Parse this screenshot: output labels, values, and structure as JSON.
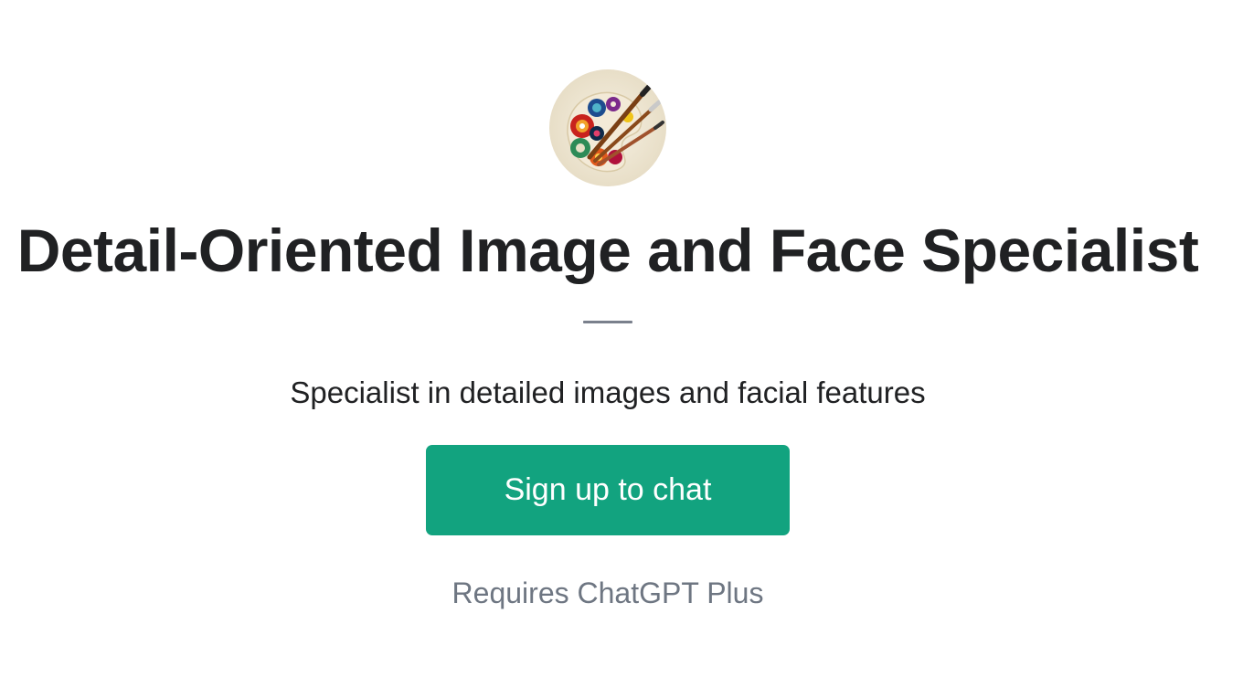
{
  "gpt": {
    "avatar_icon": "painter-palette-brushes-icon",
    "title": "Detail-Oriented Image and Face Specialist",
    "description": "Specialist in detailed images and facial features"
  },
  "actions": {
    "signup_label": "Sign up to chat"
  },
  "footer": {
    "requirement": "Requires ChatGPT Plus"
  },
  "colors": {
    "button_bg": "#12a37f",
    "button_text": "#ffffff",
    "title_text": "#202123",
    "muted_text": "#6e7682",
    "divider": "#7a808c"
  }
}
